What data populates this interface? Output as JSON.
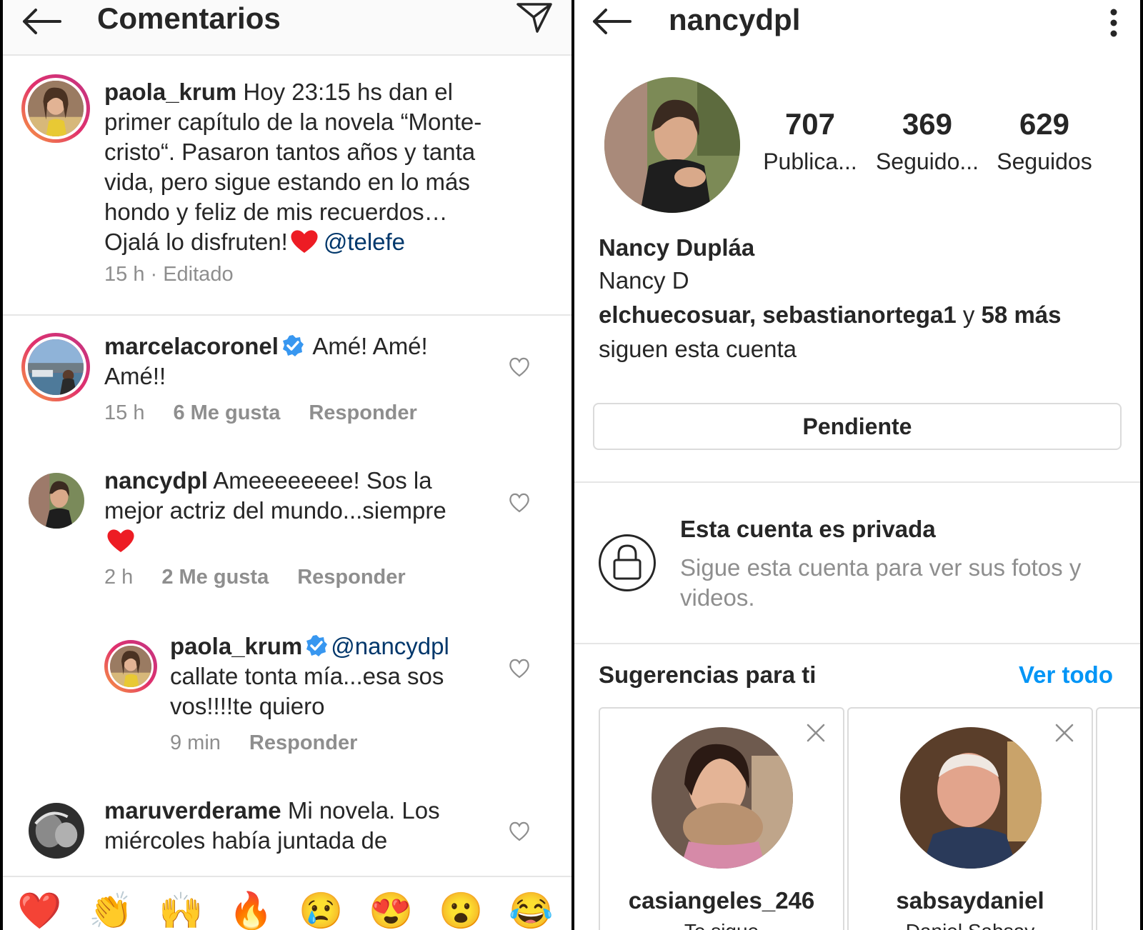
{
  "left": {
    "title": "Comentarios",
    "caption": {
      "user": "paola_krum",
      "lines": [
        " Hoy 23:15 hs dan el",
        "primer capítulo de la novela “Monte-",
        "cristo“. Pasaron tantos años y tanta",
        "vida, pero sigue estando en lo más",
        "hondo y feliz de mis recuerdos…",
        "Ojalá lo disfruten!"
      ],
      "mention": "@telefe",
      "meta": "15 h · Editado"
    },
    "comments": [
      {
        "user": "marcelacoronel",
        "line1": " Amé! Amé!",
        "line2": "Amé!!",
        "time": "15 h",
        "likes": "6 Me gusta",
        "reply": "Responder"
      },
      {
        "user": "nancydpl",
        "line1": " Ameeeeeeee! Sos la",
        "line2": "mejor actriz del mundo...siempre",
        "time": "2 h",
        "likes": "2 Me gusta",
        "reply": "Responder"
      },
      {
        "user": "paola_krum",
        "mention": "@nancydpl",
        "line2": "callate tonta mía...esa sos",
        "line3": "vos!!!!te quiero",
        "time": "9 min",
        "reply": "Responder"
      },
      {
        "user": "maruverderame",
        "line1": " Mi novela. Los",
        "line2": "miércoles había juntada de"
      }
    ],
    "emojis": [
      "❤️",
      "👏",
      "🙌",
      "🔥",
      "😢",
      "😍",
      "😮",
      "😂"
    ]
  },
  "right": {
    "username": "nancydpl",
    "stats": [
      {
        "value": "707",
        "label": "Publica..."
      },
      {
        "value": "369",
        "label": "Seguido..."
      },
      {
        "value": "629",
        "label": "Seguidos"
      }
    ],
    "full_name": "Nancy Dupláa",
    "bio": "Nancy D",
    "followed_by_users": "elchuecosuar, sebastianortega1",
    "followed_by_and": " y ",
    "followed_by_more": "58 más",
    "followed_by_suffix": "siguen esta cuenta",
    "pending_button": "Pendiente",
    "private_title": "Esta cuenta es privada",
    "private_sub": "Sigue esta cuenta para ver sus fotos y videos.",
    "suggestions_title": "Sugerencias para ti",
    "see_all": "Ver todo",
    "suggestions": [
      {
        "name": "casiangeles_246",
        "sub": "Te sigue"
      },
      {
        "name": "sabsaydaniel",
        "sub": "Daniel Sabsay"
      }
    ]
  },
  "colors": {
    "link_blue": "#0095f6",
    "mention_blue": "#00376b",
    "verified_blue": "#3897f0",
    "heart_red": "#ed1c24",
    "muted_gray": "#8e8e8e"
  }
}
